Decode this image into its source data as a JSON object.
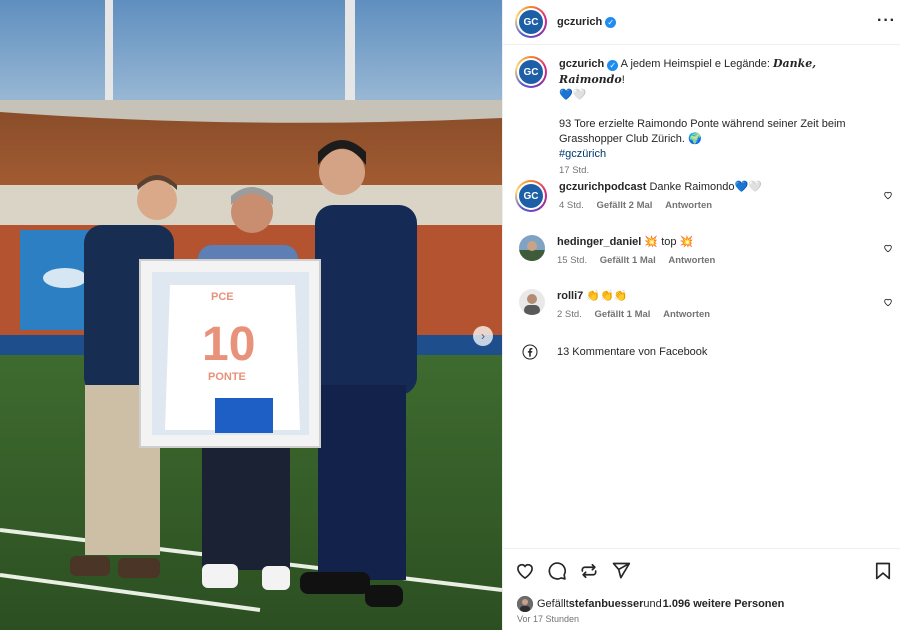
{
  "post": {
    "username": "gczurich",
    "avatar_text": "GC",
    "more_icon": "more-horizontal-icon",
    "next_icon": "chevron-right-icon"
  },
  "photo": {
    "jersey_number": "10",
    "jersey_name": "PONTE",
    "jersey_sponsor": "PCE"
  },
  "caption": {
    "username": "gczurich",
    "text_a": " A jedem Heimspiel e Legände: ",
    "text_emph": "Danke, Raimondo",
    "text_b": "!",
    "hearts": "💙🤍",
    "text_2": "93 Tore erzielte Raimondo Ponte während seiner Zeit beim Grasshopper Club Zürich. ",
    "globe": "🌍",
    "hashtag": "#gczürich",
    "time": "17 Std."
  },
  "comments": [
    {
      "username": "gczurichpodcast",
      "text": "Danke Raimondo",
      "emoji": "💙🤍",
      "time": "4 Std.",
      "likes": "Gefällt 2 Mal",
      "reply": "Antworten"
    },
    {
      "username": "hedinger_daniel",
      "text": "top",
      "emoji_pre": "💥",
      "emoji_post": "💥",
      "time": "15 Std.",
      "likes": "Gefällt 1 Mal",
      "reply": "Antworten"
    },
    {
      "username": "rolli7",
      "emoji": "👏👏👏",
      "time": "2 Std.",
      "likes": "Gefällt 1 Mal",
      "reply": "Antworten"
    }
  ],
  "facebook": {
    "label": "13 Kommentare von Facebook"
  },
  "footer": {
    "liked_prefix": "Gefällt ",
    "liked_user": "stefanbuesser",
    "liked_mid": " und ",
    "liked_count": "1.096 weitere Personen",
    "time": "Vor 17 Stunden"
  },
  "colors": {
    "accent_blue": "#1f8cf0",
    "text": "#262626",
    "muted": "#737373",
    "club_blue": "#1d5fa6"
  }
}
